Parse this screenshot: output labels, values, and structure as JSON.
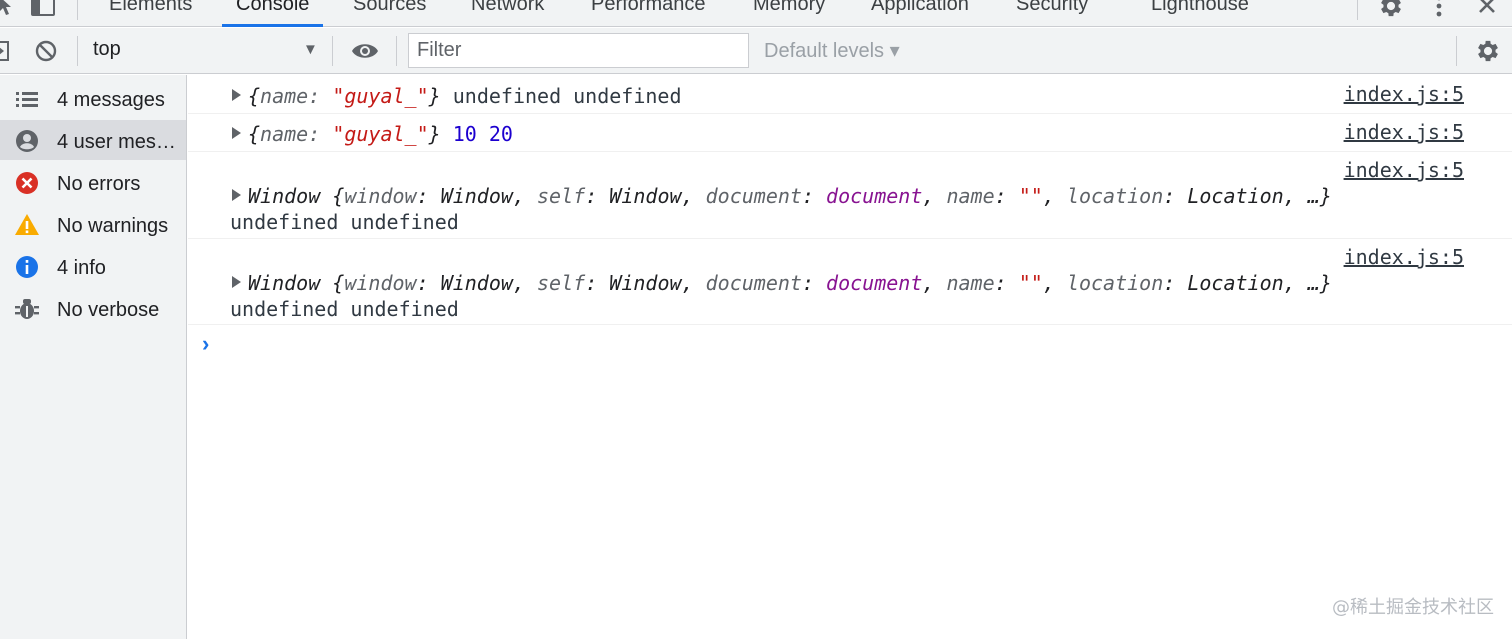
{
  "tabs": [
    {
      "label": "Elements"
    },
    {
      "label": "Console"
    },
    {
      "label": "Sources"
    },
    {
      "label": "Network"
    },
    {
      "label": "Performance"
    },
    {
      "label": "Memory"
    },
    {
      "label": "Application"
    },
    {
      "label": "Security"
    },
    {
      "label": "Lighthouse"
    }
  ],
  "active_tab": "Console",
  "toolbar": {
    "context": "top",
    "filter_placeholder": "Filter",
    "levels": "Default levels ▾"
  },
  "sidebar": {
    "items": [
      {
        "label": "4 messages",
        "icon": "list-icon"
      },
      {
        "label": "4 user mes…",
        "icon": "user-icon",
        "selected": true
      },
      {
        "label": "No errors",
        "icon": "error-icon"
      },
      {
        "label": "No warnings",
        "icon": "warning-icon"
      },
      {
        "label": "4 info",
        "icon": "info-icon"
      },
      {
        "label": "No verbose",
        "icon": "bug-icon"
      }
    ]
  },
  "console": {
    "source": "index.js:5",
    "messages": [
      {
        "obj_open": "{",
        "key": "name",
        "colon": ": ",
        "value": "\"guyal_\"",
        "obj_close": "}",
        "rest": "undefined undefined"
      },
      {
        "obj_open": "{",
        "key": "name",
        "colon": ": ",
        "value": "\"guyal_\"",
        "obj_close": "}",
        "n1": "10",
        "n2": "20"
      },
      {
        "text": "Window {window: Window, self: Window, document: document, name: \"\", location: Location, …}",
        "rest": "undefined undefined"
      },
      {
        "text": "Window {window: Window, self: Window, document: document, name: \"\", location: Location, …}",
        "rest": "undefined undefined"
      }
    ],
    "window_parts": {
      "head": "Window {",
      "k1": "window",
      "v1": "Window",
      "k2": "self",
      "v2": "Window",
      "k3": "document",
      "v3": "document",
      "k4": "name",
      "v4": "\"\"",
      "k5": "location",
      "v5": "Location",
      "tail": "…}"
    }
  },
  "watermark": "@稀土掘金技术社区",
  "colors": {
    "accent": "#1a73e8",
    "string": "#c41a16",
    "number": "#1c00cf",
    "object": "#881391",
    "error": "#d93025",
    "warning": "#f9ab00"
  }
}
